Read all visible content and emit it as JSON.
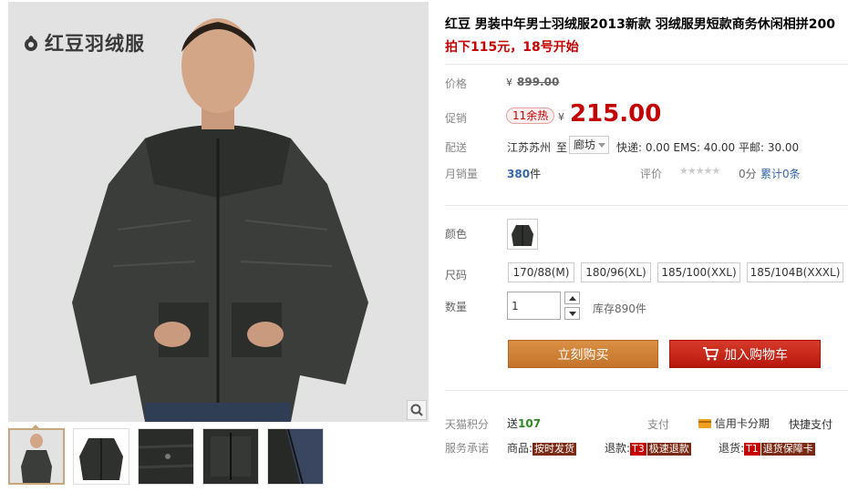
{
  "brand": {
    "name": "红豆羽绒服"
  },
  "product": {
    "title": "红豆 男装中年男士羽绒服2013新款 羽绒服男短款商务休闲相拼200",
    "subtitle": "拍下115元，18号开始"
  },
  "price": {
    "label": "价格",
    "currency": "¥",
    "original": "899.00"
  },
  "promo": {
    "label": "促销",
    "tag": "11余热",
    "currency": "¥",
    "price": "215.00"
  },
  "shipping": {
    "label": "配送",
    "from": "江苏苏州",
    "to_word": "至",
    "destination": "廊坊",
    "fees": "快递: 0.00 EMS: 40.00 平邮: 30.00"
  },
  "sales": {
    "label": "月销量",
    "count": "380",
    "unit": "件",
    "rating_label": "评价",
    "stars": "★★★★★",
    "score": "0分",
    "reviews": "累计0条"
  },
  "color": {
    "label": "颜色"
  },
  "size": {
    "label": "尺码",
    "options": [
      "170/88(M)",
      "180/96(XL)",
      "185/100(XXL)",
      "185/104B(XXXL)"
    ]
  },
  "quantity": {
    "label": "数量",
    "value": "1",
    "stock": "库存890件"
  },
  "actions": {
    "buy_now": "立刻购买",
    "add_to_cart": "加入购物车"
  },
  "points": {
    "label": "天猫积分",
    "send": "送",
    "amount": "107",
    "pay_label": "支付",
    "credit_installment": "信用卡分期",
    "quick_pay": "快捷支付"
  },
  "services": {
    "label": "服务承诺",
    "goods_label": "商品:",
    "goods_value": "按时发货",
    "refund_label": "退款:",
    "refund_code": "T3",
    "refund_value": "极速退款",
    "return_label": "退货:",
    "return_code": "T1",
    "return_value": "退货保障卡"
  },
  "colors": {
    "accent_red": "#c40000",
    "buy_orange": "#d98f44",
    "cart_red": "#c8200f",
    "link_blue": "#3366aa",
    "green": "#2e8b22"
  }
}
